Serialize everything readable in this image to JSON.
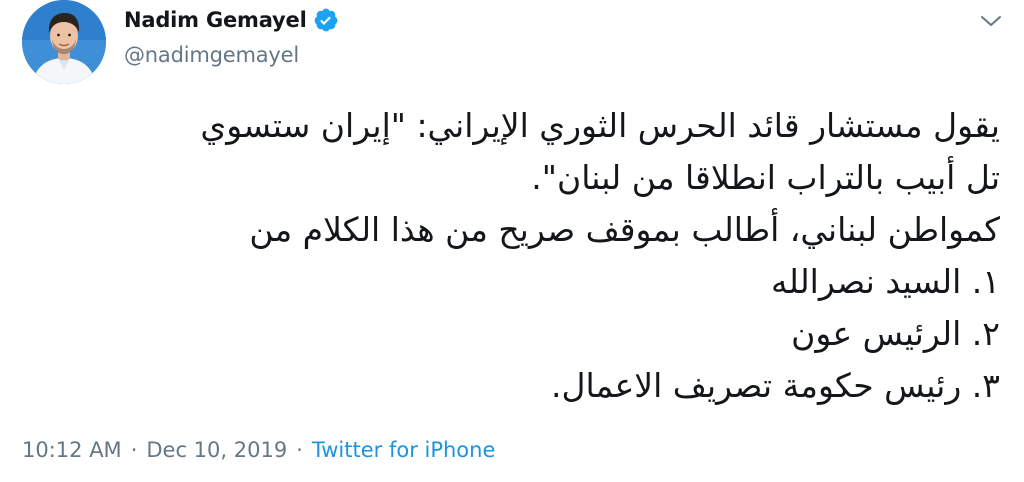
{
  "author": {
    "display_name": "Nadim Gemayel",
    "handle": "@nadimgemayel",
    "verified": true
  },
  "tweet": {
    "lines": [
      "يقول مستشار قائد الحرس الثوري الإيراني: \"إيران ستسوي",
      "تل أبيب بالتراب انطلاقا من لبنان\".",
      "كمواطن لبناني، أطالب بموقف صريح من هذا الكلام من",
      "١. السيد نصرالله",
      "٢. الرئيس عون",
      "٣. رئيس حكومة تصريف الاعمال."
    ]
  },
  "meta": {
    "time": "10:12 AM",
    "separator": "·",
    "date": "Dec 10, 2019",
    "source": "Twitter for iPhone"
  },
  "icons": {
    "verified": "verified-badge-icon",
    "caret": "chevron-down-icon"
  },
  "colors": {
    "verified": "#1da1f2",
    "link": "#1b95e0",
    "secondary_text": "#657786",
    "primary_text": "#14171a"
  }
}
